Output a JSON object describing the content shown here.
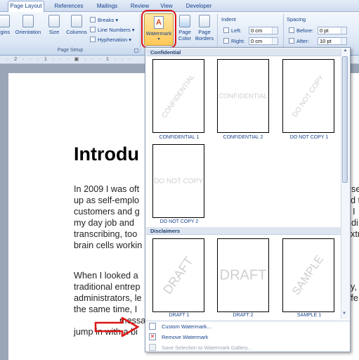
{
  "tabs": [
    "Page Layout",
    "References",
    "Mailings",
    "Review",
    "View",
    "Developer"
  ],
  "ribbon": {
    "margins_label": "rgins",
    "orientation_label": "Orientation",
    "size_label": "Size",
    "columns_label": "Columns",
    "breaks_label": "Breaks ▾",
    "line_numbers_label": "Line Numbers ▾",
    "hyphenation_label": "Hyphenation ▾",
    "page_setup_label": "Page Setup",
    "watermark_label": "Watermark",
    "page_color_label": "Page Color",
    "page_borders_label": "Page Borders",
    "indent_label": "Indent",
    "left_label": "Left:",
    "left_value": "0 cm",
    "right_label": "Right:",
    "right_value": "0 cm",
    "spacing_label": "Spacing",
    "before_label": "Before:",
    "before_value": "0 pt",
    "after_label": "After:",
    "after_value": "10 pt"
  },
  "document": {
    "heading": "Introdu",
    "p1": [
      "In 2009 I was oft",
      "up as self-emplo",
      "customers and g",
      "my day job and",
      "transcribing, too",
      "brain cells workin"
    ],
    "p1_right": [
      "se",
      "d t",
      "I",
      "di",
      "xtr",
      ""
    ],
    "p2": [
      "When I looked a",
      "traditional entrep",
      "administrators, le",
      "the same time, I",
      "message that",
      "jump in with a bi"
    ],
    "p2_right": [
      "",
      "y,",
      "ffe",
      "",
      "",
      ""
    ]
  },
  "gallery": {
    "section_confidential": "Confidential",
    "section_disclaimers": "Disclaimers",
    "items_confidential": [
      {
        "text": "CONFIDENTIAL",
        "caption": "CONFIDENTIAL 1"
      },
      {
        "text": "CONFIDENTIAL",
        "caption": "CONFIDENTIAL 2"
      },
      {
        "text": "DO NOT COPY",
        "caption": "DO NOT COPY 1"
      },
      {
        "text": "DO NOT COPY",
        "caption": "DO NOT COPY 2"
      }
    ],
    "items_disclaimers": [
      {
        "text": "DRAFT",
        "caption": "DRAFT 1"
      },
      {
        "text": "DRAFT",
        "caption": "DRAFT 2"
      },
      {
        "text": "SAMPLE",
        "caption": "SAMPLE 1"
      }
    ],
    "menu": [
      "Custom Watermark...",
      "Remove Watermark",
      "Save Selection to Watermark Gallery..."
    ]
  },
  "colors": {
    "highlight": "#e01414",
    "ribbon_text": "#15428b"
  }
}
